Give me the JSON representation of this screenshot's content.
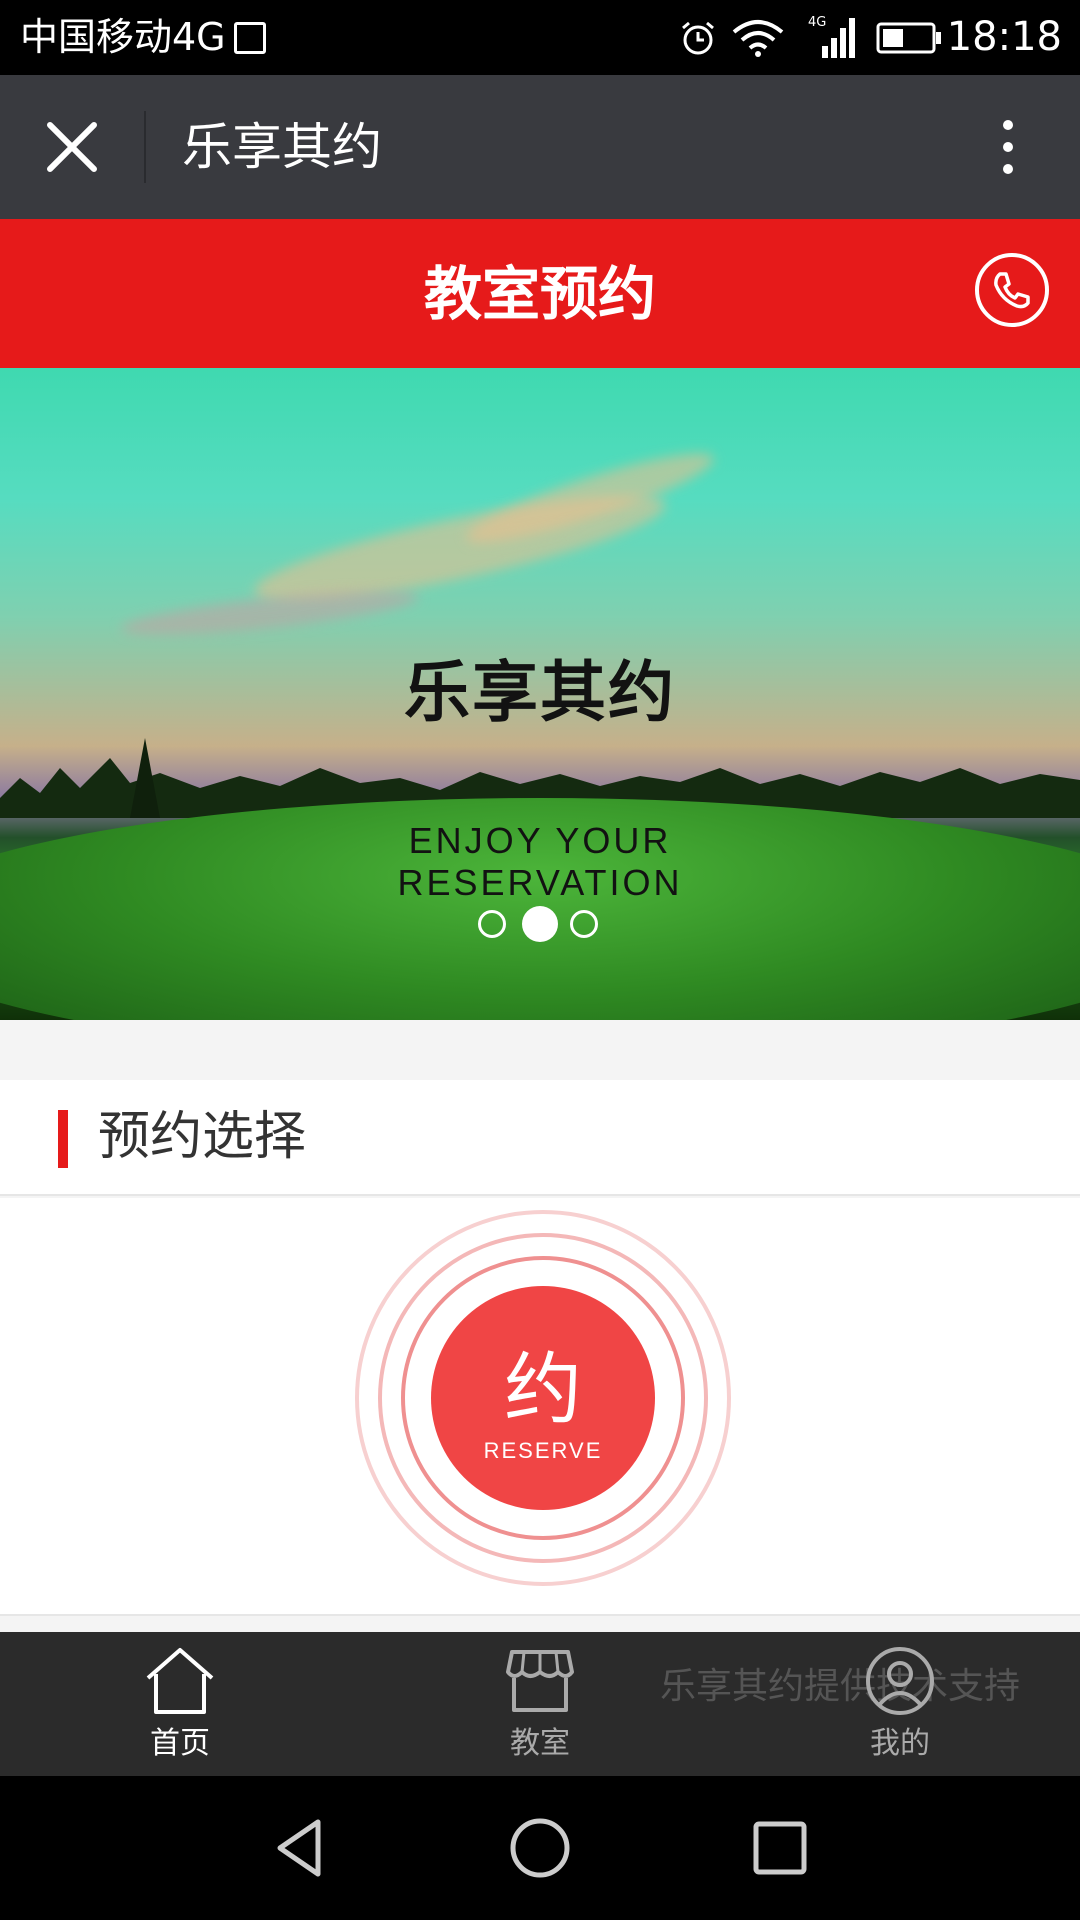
{
  "status_bar": {
    "carrier": "中国移动4G",
    "network_badge": "4G",
    "time": "18:18",
    "icons": [
      "image-icon",
      "alarm-icon",
      "wifi-icon",
      "signal-icon",
      "battery-icon"
    ]
  },
  "nav_bar": {
    "title": "乐享其约",
    "close_icon": "close-icon",
    "more_icon": "more-icon"
  },
  "header": {
    "title": "教室预约",
    "phone_icon": "phone-icon",
    "color": "#e61a1a"
  },
  "banner": {
    "brand_cn": "乐享其约",
    "brand_en_line1": "ENJOY YOUR",
    "brand_en_line2": "RESERVATION",
    "slide_count": 3,
    "active_slide": 2
  },
  "section": {
    "title": "预约选择"
  },
  "reserve_button": {
    "char": "约",
    "label": "RESERVE",
    "color": "#f04545"
  },
  "tabs": [
    {
      "label": "首页",
      "icon": "home-icon",
      "active": true
    },
    {
      "label": "教室",
      "icon": "store-icon",
      "active": false
    },
    {
      "label": "我的",
      "icon": "user-icon",
      "active": false
    }
  ],
  "footer": {
    "support_text": "乐享其约提供技术支持"
  },
  "system_nav": {
    "icons": [
      "back-icon",
      "home-circle-icon",
      "recents-icon"
    ]
  }
}
